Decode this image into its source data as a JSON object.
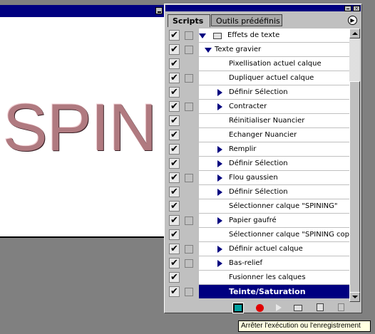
{
  "document": {
    "canvas_text": "SPIN"
  },
  "palette": {
    "tabs": [
      {
        "label": "Scripts",
        "active": true
      },
      {
        "label": "Outils prédéfinis",
        "active": false
      }
    ],
    "close_glyph": "×"
  },
  "rows": [
    {
      "label": "Effets de texte",
      "checked": true,
      "dialog": true,
      "type": "set",
      "expanded": true
    },
    {
      "label": "Texte gravier",
      "checked": true,
      "dialog": true,
      "type": "action",
      "expanded": true
    },
    {
      "label": "Pixellisation actuel calque",
      "checked": true,
      "dialog": false,
      "type": "step",
      "expandable": false
    },
    {
      "label": "Dupliquer actuel calque",
      "checked": true,
      "dialog": true,
      "type": "step",
      "expandable": false
    },
    {
      "label": "Définir Sélection",
      "checked": true,
      "dialog": false,
      "type": "step",
      "expandable": true
    },
    {
      "label": "Contracter",
      "checked": true,
      "dialog": true,
      "type": "step",
      "expandable": true
    },
    {
      "label": "Réinitialiser Nuancier",
      "checked": true,
      "dialog": false,
      "type": "step",
      "expandable": false
    },
    {
      "label": "Echanger Nuancier",
      "checked": true,
      "dialog": false,
      "type": "step",
      "expandable": false
    },
    {
      "label": "Remplir",
      "checked": true,
      "dialog": false,
      "type": "step",
      "expandable": true
    },
    {
      "label": "Définir Sélection",
      "checked": true,
      "dialog": false,
      "type": "step",
      "expandable": true
    },
    {
      "label": "Flou gaussien",
      "checked": true,
      "dialog": true,
      "type": "step",
      "expandable": true
    },
    {
      "label": "Définir Sélection",
      "checked": true,
      "dialog": false,
      "type": "step",
      "expandable": true
    },
    {
      "label": "Sélectionner calque \"SPINING\"",
      "checked": true,
      "dialog": false,
      "type": "step",
      "expandable": false
    },
    {
      "label": "Papier gaufré",
      "checked": true,
      "dialog": true,
      "type": "step",
      "expandable": true
    },
    {
      "label": "Sélectionner calque \"SPINING copie\"",
      "checked": true,
      "dialog": false,
      "type": "step",
      "expandable": false
    },
    {
      "label": "Définir actuel calque",
      "checked": true,
      "dialog": true,
      "type": "step",
      "expandable": true
    },
    {
      "label": "Bas-relief",
      "checked": true,
      "dialog": true,
      "type": "step",
      "expandable": true
    },
    {
      "label": "Fusionner les calques",
      "checked": true,
      "dialog": false,
      "type": "step",
      "expandable": false
    },
    {
      "label": "Teinte/Saturation",
      "checked": true,
      "dialog": true,
      "type": "step",
      "expandable": true,
      "selected": true
    }
  ],
  "checkmark_glyph": "✔",
  "tooltip": {
    "text": "Arrêter l'exécution ou l'enregistrement"
  },
  "colors": {
    "selection": "#000080",
    "title_bar": "#000080",
    "record": "#e00000",
    "stop": "#00a0a0"
  }
}
